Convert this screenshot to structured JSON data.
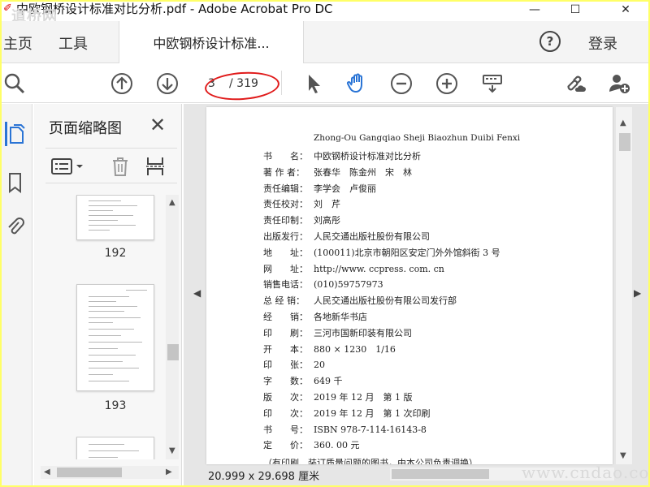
{
  "window": {
    "title": "中欧钢桥设计标准对比分析.pdf - Adobe Acrobat Pro DC",
    "watermark": "道桥网",
    "minimize": "—",
    "maximize": "☐",
    "close": "✕"
  },
  "tabs": {
    "home": "主页",
    "tools": "工具",
    "document": "中欧钢桥设计标准...",
    "help": "?",
    "login": "登录"
  },
  "toolbar": {
    "current_page": "3",
    "total_pages": "/ 319"
  },
  "panel": {
    "title": "页面缩略图",
    "close": "✕",
    "thumbnails": [
      {
        "page": "192"
      },
      {
        "page": "193"
      }
    ]
  },
  "document": {
    "header_line": "Zhong-Ou Gangqiao Sheji Biaozhun Duibi Fenxi",
    "rows": [
      {
        "label": "书　　名：",
        "value": "中欧钢桥设计标准对比分析"
      },
      {
        "label": "著 作 者：",
        "value": "张春华　陈金州　宋　林"
      },
      {
        "label": "责任编辑：",
        "value": "李学会　卢俊丽"
      },
      {
        "label": "责任校对：",
        "value": "刘　芹"
      },
      {
        "label": "责任印制：",
        "value": "刘高彤"
      },
      {
        "label": "出版发行：",
        "value": "人民交通出版社股份有限公司"
      },
      {
        "label": "地　　址：",
        "value": "(100011)北京市朝阳区安定门外外馆斜街 3 号"
      },
      {
        "label": "网　　址：",
        "value": "http://www. ccpress. com. cn"
      },
      {
        "label": "销售电话：",
        "value": "(010)59757973"
      },
      {
        "label": "总 经 销：",
        "value": "人民交通出版社股份有限公司发行部"
      },
      {
        "label": "经　　销：",
        "value": "各地新华书店"
      },
      {
        "label": "印　　刷：",
        "value": "三河市国新印装有限公司"
      },
      {
        "label": "开　　本：",
        "value": "880 × 1230　1/16"
      },
      {
        "label": "印　　张：",
        "value": "20"
      },
      {
        "label": "字　　数：",
        "value": "649 千"
      },
      {
        "label": "版　　次：",
        "value": "2019 年 12 月　第 1 版"
      },
      {
        "label": "印　　次：",
        "value": "2019 年 12 月　第 1 次印刷"
      },
      {
        "label": "书　　号：",
        "value": "ISBN 978-7-114-16143-8"
      },
      {
        "label": "定　　价：",
        "value": "360. 00 元"
      }
    ],
    "note": "（有印刷、装订质量问题的图书，由本公司负责调换）",
    "dimensions": "20.999 x 29.698 厘米",
    "watermark": "www.cndao.com"
  }
}
